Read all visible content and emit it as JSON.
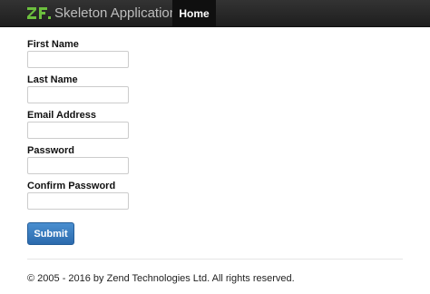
{
  "navbar": {
    "brand_text": "Skeleton Application",
    "logo_icon": "zend-framework-logo-icon",
    "home_label": "Home"
  },
  "form": {
    "fields": [
      {
        "label": "First Name",
        "value": ""
      },
      {
        "label": "Last Name",
        "value": ""
      },
      {
        "label": "Email Address",
        "value": ""
      },
      {
        "label": "Password",
        "value": ""
      },
      {
        "label": "Confirm Password",
        "value": ""
      }
    ],
    "submit_label": "Submit"
  },
  "footer": {
    "text": "© 2005 - 2016 by Zend Technologies Ltd. All rights reserved."
  },
  "colors": {
    "navbar_bg": "#222222",
    "logo_green": "#6cbf3e",
    "submit_blue": "#357ebd"
  }
}
